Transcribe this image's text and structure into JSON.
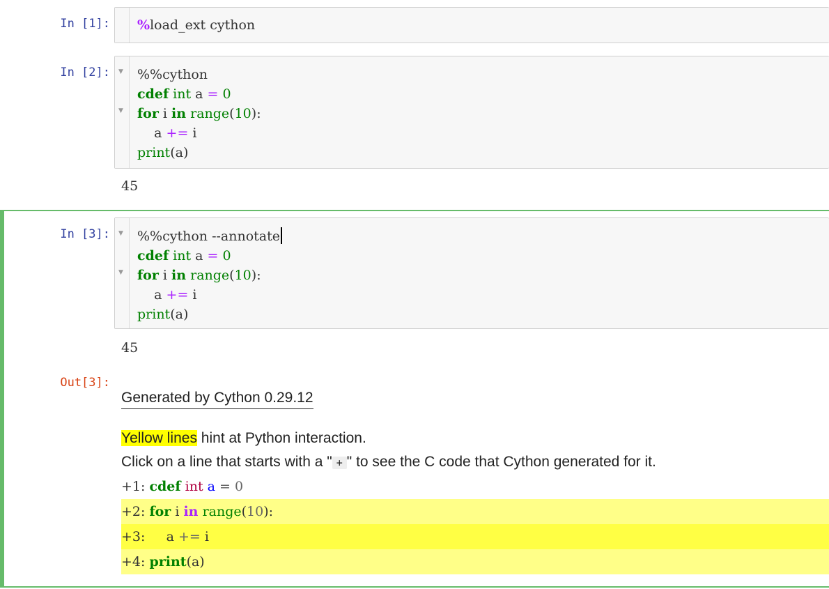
{
  "cells": [
    {
      "prompt": "In [1]:",
      "lines": [
        "%load_ext cython"
      ]
    },
    {
      "prompt": "In [2]:",
      "lines": [
        "%%cython",
        "cdef int a = 0",
        "for i in range(10):",
        "    a += i",
        "print(a)"
      ],
      "output": "45"
    },
    {
      "prompt": "In [3]:",
      "lines": [
        "%%cython --annotate",
        "cdef int a = 0",
        "for i in range(10):",
        "    a += i",
        "print(a)"
      ],
      "output": "45",
      "out_prompt": "Out[3]:"
    }
  ],
  "annotation": {
    "title": "Generated by Cython 0.29.12",
    "hint_highlight": "Yellow lines",
    "hint_rest": " hint at Python interaction.",
    "click_before": "Click on a line that starts with a \"",
    "click_plus": "+",
    "click_after": "\" to see the C code that Cython generated for it.",
    "lines": [
      {
        "prefix": "+1: ",
        "text": "cdef int a = 0"
      },
      {
        "prefix": "+2: ",
        "text": "for i in range(10):"
      },
      {
        "prefix": "+3: ",
        "text": "    a += i"
      },
      {
        "prefix": "+4: ",
        "text": "print(a)"
      }
    ]
  },
  "colors": {
    "selected_border": "#66bb6a",
    "prompt_in": "#303f9f",
    "prompt_out": "#d84315",
    "highlight": "#ffff00"
  }
}
